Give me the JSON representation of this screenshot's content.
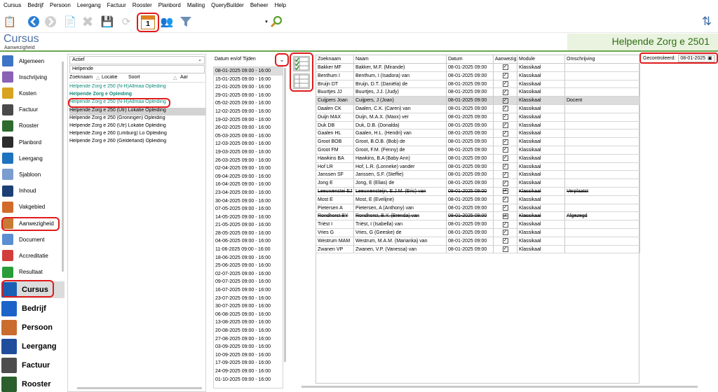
{
  "menu": [
    "Cursus",
    "Bedrijf",
    "Persoon",
    "Leergang",
    "Factuur",
    "Rooster",
    "Planbord",
    "Mailing",
    "QueryBuilder",
    "Beheer",
    "Help"
  ],
  "toolbar": {
    "calendar_day": "1"
  },
  "header": {
    "module_title": "Cursus",
    "module_subtitle": "Aanwezigheid",
    "record_title": "Helpende Zorg e 2501"
  },
  "leftnav": {
    "items": [
      {
        "label": "Algemeen",
        "color": "#3e75c4"
      },
      {
        "label": "Inschrijving",
        "color": "#8a63b5"
      },
      {
        "label": "Kosten",
        "color": "#d7a321"
      },
      {
        "label": "Factuur",
        "color": "#4a4a4a"
      },
      {
        "label": "Rooster",
        "color": "#2e6b2f"
      },
      {
        "label": "Planbord",
        "color": "#2c2c2c"
      },
      {
        "label": "Leergang",
        "color": "#1e73be"
      },
      {
        "label": "Sjabloon",
        "color": "#7a9ccf"
      },
      {
        "label": "Inhoud",
        "color": "#1c3f75"
      },
      {
        "label": "Vakgebied",
        "color": "#d26a2c"
      },
      {
        "label": "Aanwezigheid",
        "color": "#c77a33"
      },
      {
        "label": "Document",
        "color": "#5a8ed1"
      },
      {
        "label": "Accreditatie",
        "color": "#d23c3c"
      },
      {
        "label": "Resultaat",
        "color": "#2a9d3a"
      }
    ],
    "big_items": [
      {
        "label": "Cursus",
        "color": "#1a5fb4"
      },
      {
        "label": "Bedrijf",
        "color": "#1c63c9"
      },
      {
        "label": "Persoon",
        "color": "#c96c2e"
      },
      {
        "label": "Leergang",
        "color": "#1f4f9c"
      },
      {
        "label": "Factuur",
        "color": "#4d4d4d"
      },
      {
        "label": "Rooster",
        "color": "#2b5f2c"
      }
    ]
  },
  "listpanel": {
    "status": "Actief",
    "filter": "Helpende",
    "columns": [
      "Zoeknaam",
      "Locatie",
      "Soort",
      "Aar"
    ],
    "rows": [
      {
        "text": "Helpende Zorg e 250 (N-H)Allmaa Opleiding",
        "style": "teal"
      },
      {
        "text": "Helpende Zorg e       Opleiding",
        "style": "teal bold"
      },
      {
        "text": "Helpende Zorg e 250 (N-H)Allmaa Opleiding",
        "style": "teal"
      },
      {
        "text": "Helpende Zorg e 250 (Utr) Lokatie Opleiding",
        "style": "sel"
      },
      {
        "text": "Helpende Zorg e 250 (Groningen) Opleiding",
        "style": ""
      },
      {
        "text": "Helpende Zorg e 260 (Utr) Lokatie Opleiding",
        "style": ""
      },
      {
        "text": "Helpende Zorg e 260 (Limburg) Lo Opleiding",
        "style": ""
      },
      {
        "text": "Helpende Zorg e 260 (Gelderland) Opleiding",
        "style": ""
      }
    ]
  },
  "dates": {
    "combo_label": "Datum en/of Tijden",
    "rows": [
      "08-01-2025  09:00 - 16:00",
      "15-01-2025  09:00 - 16:00",
      "22-01-2025  09:00 - 16:00",
      "29-01-2025  09:00 - 16:00",
      "05-02-2025  09:00 - 16:00",
      "12-02-2025  09:00 - 16:00",
      "19-02-2025  09:00 - 16:00",
      "26-02-2025  09:00 - 16:00",
      "05-03-2025  09:00 - 16:00",
      "12-03-2025  09:00 - 16:00",
      "19-03-2025  09:00 - 16:00",
      "26-03-2025  09:00 - 16:00",
      "02-04-2025  09:00 - 16:00",
      "09-04-2025  09:00 - 16:00",
      "16-04-2025  09:00 - 16:00",
      "23-04-2025  09:00 - 16:00",
      "30-04-2025  09:00 - 16:00",
      "07-05-2025  09:00 - 16:00",
      "14-05-2025  09:00 - 16:00",
      "21-05-2025  09:00 - 16:00",
      "28-05-2025  09:00 - 16:00",
      "04-06-2025  09:00 - 16:00",
      "11-06-2025  09:00 - 16:00",
      "18-06-2025  09:00 - 16:00",
      "25-06-2025  09:00 - 16:00",
      "02-07-2025  09:00 - 16:00",
      "09-07-2025  09:00 - 16:00",
      "16-07-2025  09:00 - 16:00",
      "23-07-2025  09:00 - 16:00",
      "30-07-2025  09:00 - 16:00",
      "06-08-2025  09:00 - 16:00",
      "13-08-2025  09:00 - 16:00",
      "20-08-2025  09:00 - 16:00",
      "27-08-2025  09:00 - 16:00",
      "03-09-2025  09:00 - 16:00",
      "10-09-2025  09:00 - 16:00",
      "17-09-2025  09:00 - 16:00",
      "24-09-2025  09:00 - 16:00",
      "01-10-2025  09:00 - 16:00"
    ]
  },
  "grid": {
    "columns": [
      "Zoeknaam",
      "Naam",
      "Datum",
      "Aanwezig",
      "Module",
      "Omschrijving"
    ],
    "rows": [
      {
        "z": "Bakker MF",
        "n": "Bakker, M.F. (Mirande)",
        "d": "08-01-2025 09:00",
        "m": "Klassikaal",
        "o": "",
        "s": ""
      },
      {
        "z": "Benthum I",
        "n": "Benthum, I (Isadora) van",
        "d": "08-01-2025 09:00",
        "m": "Klassikaal",
        "o": "",
        "s": ""
      },
      {
        "z": "Bruijn DT",
        "n": "Bruijn, D.T. (Daniëla) de",
        "d": "08-01-2025 09:00",
        "m": "Klassikaal",
        "o": "",
        "s": ""
      },
      {
        "z": "Buurtjes JJ",
        "n": "Buurtjes, J.J. (Judy)",
        "d": "08-01-2025 09:00",
        "m": "Klassikaal",
        "o": "",
        "s": ""
      },
      {
        "z": "Cuijpers Joan",
        "n": "Cuijpers, J (Joan)",
        "d": "08-01-2025 09:00",
        "m": "Klassikaal",
        "o": "Docent",
        "s": "sel"
      },
      {
        "z": "Daalen CK",
        "n": "Daalen, C.K. (Caren) van",
        "d": "08-01-2025 09:00",
        "m": "Klassikaal",
        "o": "",
        "s": ""
      },
      {
        "z": "Duijn MAX",
        "n": "Duijn, M.A.X. (Maxx) ver",
        "d": "08-01-2025 09:00",
        "m": "Klassikaal",
        "o": "",
        "s": ""
      },
      {
        "z": "Duk DB",
        "n": "Duk, D.B. (Donalda)",
        "d": "08-01-2025 09:00",
        "m": "Klassikaal",
        "o": "",
        "s": ""
      },
      {
        "z": "Gaalen HL",
        "n": "Gaalen, H.L. (Hendri) van",
        "d": "08-01-2025 09:00",
        "m": "Klassikaal",
        "o": "",
        "s": ""
      },
      {
        "z": "Groot BOB",
        "n": "Groot, B.O.B. (Bob) de",
        "d": "08-01-2025 09:00",
        "m": "Klassikaal",
        "o": "",
        "s": ""
      },
      {
        "z": "Groot FM",
        "n": "Groot, F.M. (Fenny) de",
        "d": "08-01-2025 09:00",
        "m": "Klassikaal",
        "o": "",
        "s": ""
      },
      {
        "z": "Hawkins BA",
        "n": "Hawkins, B.A (Baby Ann)",
        "d": "08-01-2025 09:00",
        "m": "Klassikaal",
        "o": "",
        "s": ""
      },
      {
        "z": "Hof LR",
        "n": "Hof, L.R. (Lonneke) vander",
        "d": "08-01-2025 09:00",
        "m": "Klassikaal",
        "o": "",
        "s": ""
      },
      {
        "z": "Janssen SF",
        "n": "Janssen, S.F. (Steffie)",
        "d": "08-01-2025 09:00",
        "m": "Klassikaal",
        "o": "",
        "s": ""
      },
      {
        "z": "Jong E",
        "n": "Jong, E (Elias) de",
        "d": "08-01-2025 09:00",
        "m": "Klassikaal",
        "o": "",
        "s": ""
      },
      {
        "z": "Leeuwenstei EJ",
        "n": "Leeuwensteijn, E.J.M. (Eric) van",
        "d": "08-01-2025 09:00",
        "m": "Klassikaal",
        "o": "Verplaatst",
        "s": "strike"
      },
      {
        "z": "Most E",
        "n": "Most, E (Evelijne)",
        "d": "08-01-2025 09:00",
        "m": "Klassikaal",
        "o": "",
        "s": ""
      },
      {
        "z": "Pietersen A",
        "n": "Pietersen, A (Anthony) van",
        "d": "08-01-2025 09:00",
        "m": "Klassikaal",
        "o": "",
        "s": ""
      },
      {
        "z": "Rondhorst BY",
        "n": "Rondhorst, B.Y. (Brenda) van",
        "d": "08-01-2025 09:00",
        "m": "Klassikaal",
        "o": "Afgezegd",
        "s": "strike"
      },
      {
        "z": "Triëst I",
        "n": "Triëst, I (Isabella) van",
        "d": "08-01-2025 09:00",
        "m": "Klassikaal",
        "o": "",
        "s": ""
      },
      {
        "z": "Vries G",
        "n": "Vries, G (Geeske) de",
        "d": "08-01-2025 09:00",
        "m": "Klassikaal",
        "o": "",
        "s": ""
      },
      {
        "z": "Westrum MAM",
        "n": "Westrum, M.A.M. (Marianka) van",
        "d": "08-01-2025 09:00",
        "m": "Klassikaal",
        "o": "",
        "s": ""
      },
      {
        "z": "Zwanen VP",
        "n": "Zwanen, V.P. (Vanessa) van",
        "d": "08-01-2025 09:00",
        "m": "Klassikaal",
        "o": "",
        "s": ""
      }
    ]
  },
  "gecontroleerd": {
    "label": "Gecontroleerd:",
    "date": "08-01-2025"
  },
  "colors": {
    "accent_green": "#6aa84f",
    "highlight_red": "#e01b1b",
    "teal": "#0d8a7a"
  }
}
